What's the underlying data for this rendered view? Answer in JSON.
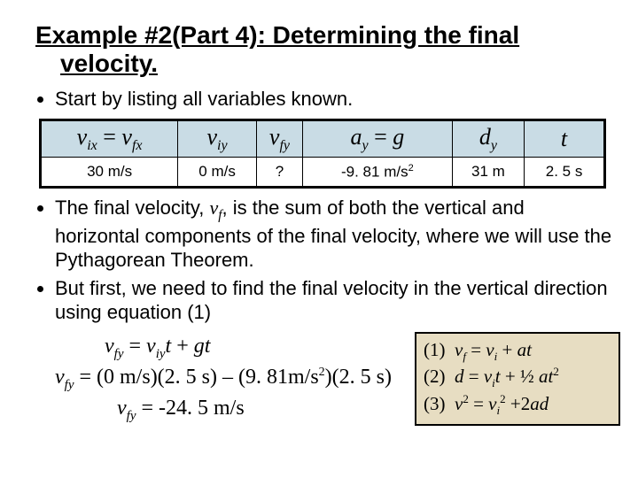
{
  "title_a": "Example #2(Part 4): Determining the final",
  "title_b": "velocity.",
  "bullet1": "Start by listing all variables known.",
  "table": {
    "h0_html": "v<sub>ix</sub> <span class='rom'>=</span> v<sub>fx</sub>",
    "h1_html": "v<sub>iy</sub>",
    "h2_html": "v<sub>fy</sub>",
    "h3_html": "a<sub>y</sub> <span class='rom'>=</span> g",
    "h4_html": "d<sub>y</sub>",
    "h5_html": "t",
    "v0": "30 m/s",
    "v1": "0 m/s",
    "v2": "?",
    "v3_html": "-9. 81 m/s<sup>2</sup>",
    "v4": "31 m",
    "v5": "2. 5 s"
  },
  "bullet2_html": "The final velocity, <span class='serif-i'>v<sub>f</sub></span>, is the sum of both the vertical and horizontal components of the final velocity, where we will use the Pythagorean Theorem.",
  "bullet3": "But first, we need to find the final velocity in the vertical direction using equation (1)",
  "calc": {
    "l1_html": "<i>v<sub>fy</sub></i> = <i>v<sub>iy</sub>t</i> + <i>gt</i>",
    "l2_html": "<i>v<sub>fy</sub></i> = (0 m/s)(2. 5 s) – (9. 81m/s<sup>2</sup>)(2. 5 s)",
    "l3_html": "<i>v<sub>fy</sub></i> = -24. 5 m/s"
  },
  "eqbox": {
    "r1_html": "(1)&nbsp;&nbsp;<i>v<sub>f</sub></i> = <i>v<sub>i</sub></i> + <i>at</i>",
    "r2_html": "(2)&nbsp;&nbsp;<i>d</i> = <i>v<sub>i</sub>t</i> + ½ <i>at</i><sup>2</sup>",
    "r3_html": "(3)&nbsp;&nbsp;<i>v</i><sup>2</sup> = <i>v<sub>i</sub></i><sup>2</sup> +2<i>ad</i>"
  }
}
